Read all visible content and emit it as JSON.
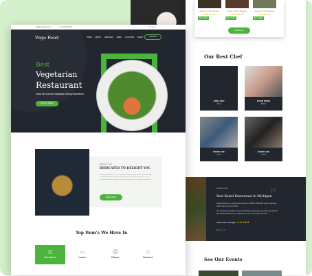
{
  "brand": {
    "name": "Vege Food",
    "accent": "#4cb43c",
    "dark": "#22262f"
  },
  "topbar": {
    "email": "info@vegefood.com",
    "phone": "+1 234 567 8910",
    "social": "f ♥ t ◎ in"
  },
  "nav": {
    "items": [
      "HOME",
      "ABOUT",
      "SERVICES",
      "MENU",
      "OUR CHEF",
      "EVENT"
    ],
    "contact": "CONTACT"
  },
  "hero": {
    "kicker": "Best",
    "title1": "Vegetarian",
    "title2": "Restaurant",
    "subtitle": "Enjoy the Gourmet Vegetarian Dining Experience!",
    "cta": "BOOK A TABLE"
  },
  "about": {
    "label": "ABOUT US",
    "title": "DEDICATED TO DELIGHT YOU",
    "body": "Lorem ipsum dolor sit amet, consectetur adipiscing elit, sed do eiusmod tempor incididunt ut labore et dolore magna aliqua. Ut enim ad minim veniam, quis nostrud exercitation ullamco laboris nisi ut aliquip ex ea commodo consequat.",
    "cta": "READ MORE"
  },
  "items": {
    "title": "Top Item's We Have In",
    "categories": [
      {
        "label": "Breakfast",
        "icon": "breakfast-icon"
      },
      {
        "label": "Lunch",
        "icon": "lunch-icon"
      },
      {
        "label": "Dinner",
        "icon": "dinner-icon"
      },
      {
        "label": "Dessert",
        "icon": "dessert-icon"
      }
    ]
  },
  "dishes": {
    "cards": [
      {
        "name": "Apple Gumbi Squares",
        "price": "Price : $.90"
      },
      {
        "name": "Apple Gumbi Squares",
        "price": "Price : $.90"
      },
      {
        "name": "Apple Gumbi Squares",
        "price": "Price : $.90"
      }
    ],
    "stars": "★★★★★",
    "view_all": "VIEW ALL"
  },
  "chefs": {
    "title": "Our Best Chef",
    "list": [
      {
        "name": "ANNA DEO",
        "role": "Chef"
      },
      {
        "name": "DAVID MORE",
        "role": "Baker"
      },
      {
        "name": "MARIO JOE",
        "role": "Chef"
      },
      {
        "name": "MARIO JOE",
        "role": "Chef"
      }
    ]
  },
  "testimonial": {
    "label": "Testimonials",
    "title": "Best Rated Restaurant In Michigan",
    "p1": "Aenean tellus arcu, vehicula quis quam vel, finibus sollicitudin quam maecenas mollis risus eu purus lobortis.",
    "p2": "The amazing atmosphere, food and staff were absolutely wonderful. We will visit the restaurant Blondie as an appetizer and it was amazing the best.",
    "author": "Susan Doe, Michigan",
    "stars": "★★★★★"
  },
  "events": {
    "title": "See Our Events"
  }
}
